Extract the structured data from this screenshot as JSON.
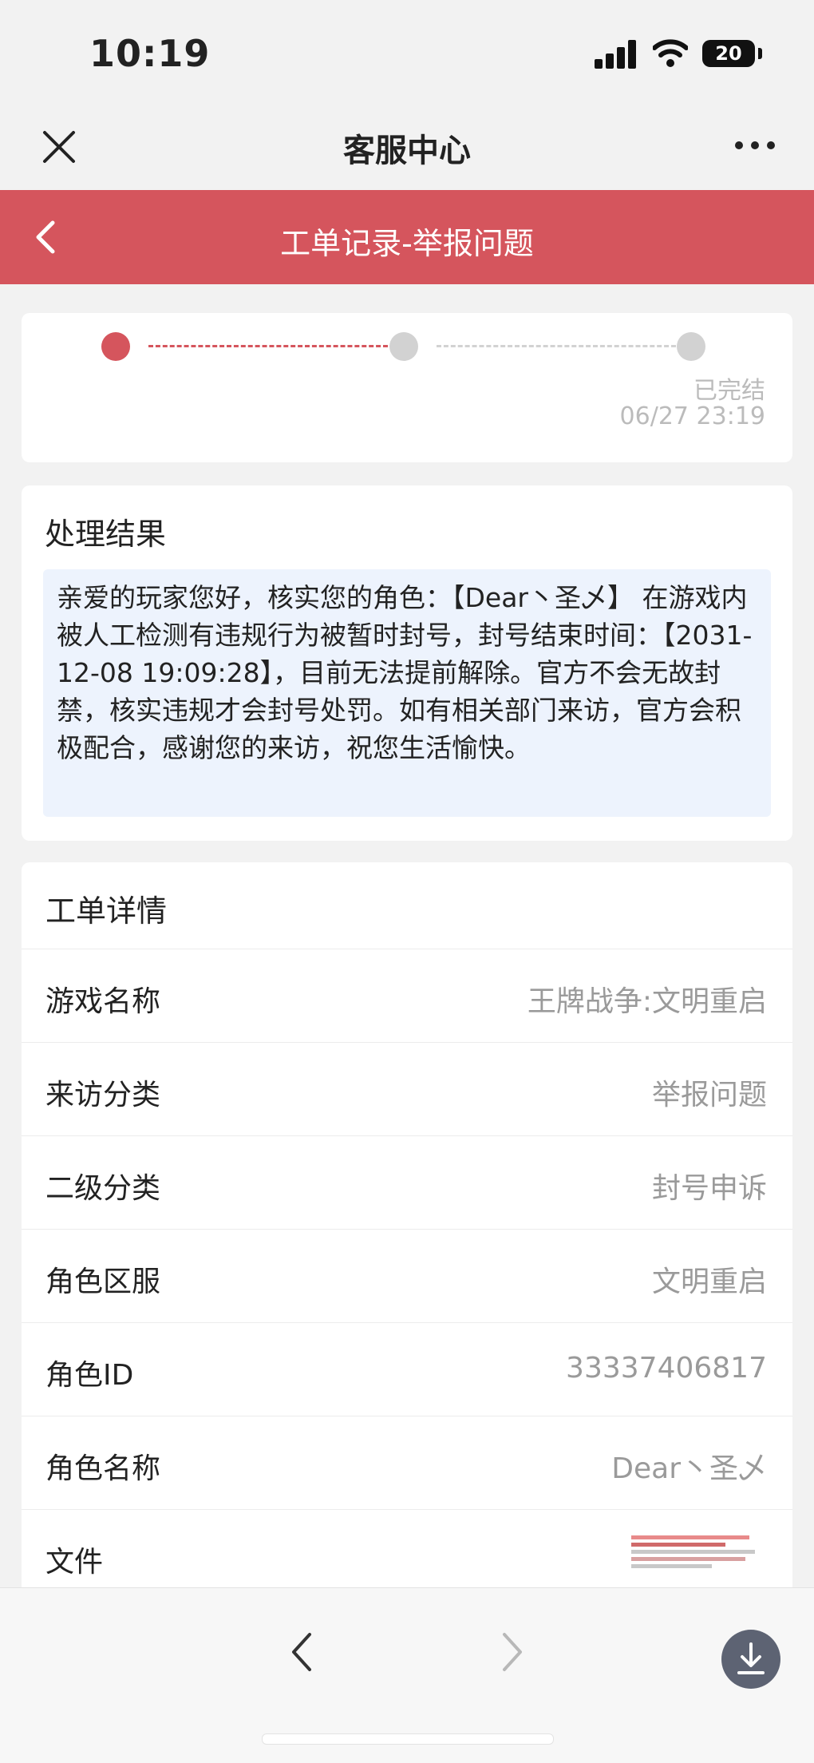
{
  "status_bar": {
    "time": "10:19",
    "battery": "20"
  },
  "navbar": {
    "title": "客服中心"
  },
  "header": {
    "title": "工单记录-举报问题"
  },
  "progress": {
    "steps": [
      {
        "state": "active"
      },
      {
        "state": "pending"
      },
      {
        "state": "pending",
        "label": "已完结",
        "time": "06/27 23:19"
      }
    ]
  },
  "result": {
    "title": "处理结果",
    "text": "亲爱的玩家您好，核实您的角色：【Dear丶圣乄】 在游戏内被人工检测有违规行为被暂时封号，封号结束时间：【2031-12-08 19:09:28】，目前无法提前解除。官方不会无故封禁，核实违规才会封号处罚。如有相关部门来访，官方会积极配合，感谢您的来访，祝您生活愉快。"
  },
  "details": {
    "title": "工单详情",
    "rows": [
      {
        "label": "游戏名称",
        "value": "王牌战争:文明重启"
      },
      {
        "label": "来访分类",
        "value": "举报问题"
      },
      {
        "label": "二级分类",
        "value": "封号申诉"
      },
      {
        "label": "角色区服",
        "value": "文明重启"
      },
      {
        "label": "角色ID",
        "value": "33337406817"
      },
      {
        "label": "角色名称",
        "value": "Dear丶圣乄"
      },
      {
        "label": "文件",
        "value": ""
      }
    ]
  },
  "colors": {
    "accent": "#d5555d",
    "result_bg": "#edf3fd",
    "download_bg": "#5d6373"
  },
  "icons": {
    "close": "close-icon",
    "more": "more-icon",
    "back": "chevron-left-icon",
    "prev": "chevron-left-icon",
    "next": "chevron-right-icon",
    "download": "download-icon"
  }
}
